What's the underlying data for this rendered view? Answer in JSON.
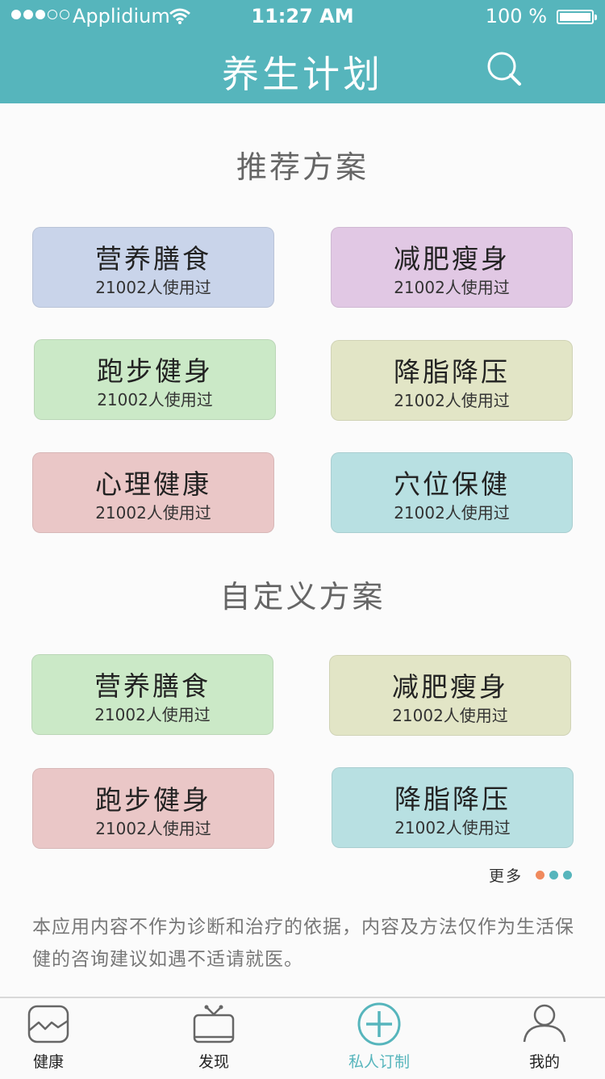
{
  "status_bar": {
    "carrier": "Applidium",
    "time": "11:27 AM",
    "battery": "100 %"
  },
  "header": {
    "title": "养生计划",
    "search_icon": "search-icon"
  },
  "recommended": {
    "title": "推荐方案",
    "cards": [
      {
        "name": "营养膳食",
        "count": "21002人使用过",
        "color": "#c9d4ea"
      },
      {
        "name": "减肥瘦身",
        "count": "21002人使用过",
        "color": "#e1c8e4"
      },
      {
        "name": "跑步健身",
        "count": "21002人使用过",
        "color": "#cbe9c7"
      },
      {
        "name": "降脂降压",
        "count": "21002人使用过",
        "color": "#e2e5c6"
      },
      {
        "name": "心理健康",
        "count": "21002人使用过",
        "color": "#eac7c7"
      },
      {
        "name": "穴位保健",
        "count": "21002人使用过",
        "color": "#b8e0e2"
      }
    ]
  },
  "custom": {
    "title": "自定义方案",
    "cards": [
      {
        "name": "营养膳食",
        "count": "21002人使用过",
        "color": "#cbe9c7"
      },
      {
        "name": "减肥瘦身",
        "count": "21002人使用过",
        "color": "#e2e5c6"
      },
      {
        "name": "跑步健身",
        "count": "21002人使用过",
        "color": "#eac7c7"
      },
      {
        "name": "降脂降压",
        "count": "21002人使用过",
        "color": "#b8e0e2"
      }
    ],
    "more_label": "更多",
    "dot_colors": [
      "#f08a5d",
      "#56b5bc",
      "#56b5bc"
    ]
  },
  "disclaimer": "本应用内容不作为诊断和治疗的依据，内容及方法仅作为生活保健的咨询建议如遇不适请就医。",
  "tabbar": {
    "items": [
      {
        "label": "健康",
        "icon": "health-chart-icon"
      },
      {
        "label": "发现",
        "icon": "tv-icon"
      },
      {
        "label": "私人订制",
        "icon": "plus-circle-icon",
        "active": true
      },
      {
        "label": "我的",
        "icon": "person-icon"
      }
    ]
  },
  "colors": {
    "accent": "#56b5bc",
    "background": "#fbfbfb"
  }
}
